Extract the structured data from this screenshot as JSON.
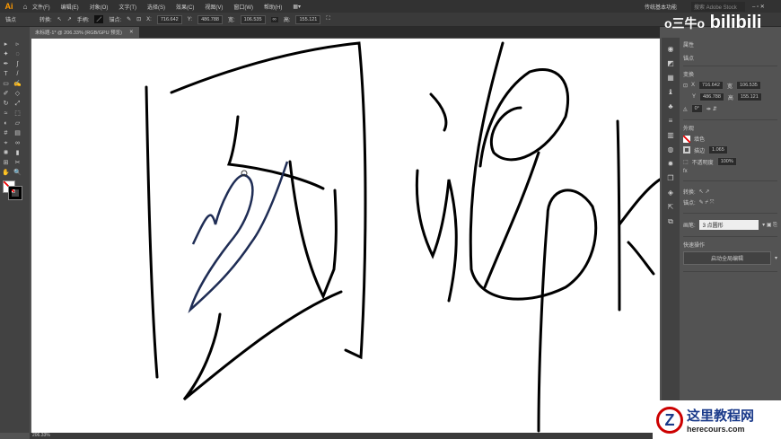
{
  "app": {
    "logo": "Ai",
    "menus": [
      "文件(F)",
      "编辑(E)",
      "对象(O)",
      "文字(T)",
      "选择(S)",
      "效果(C)",
      "视图(V)",
      "窗口(W)",
      "帮助(H)"
    ],
    "workspace": "传统基本功能",
    "search_placeholder": "搜索 Adobe Stock"
  },
  "control": {
    "mode": "锚点",
    "convert": "转换:",
    "handles": "手柄:",
    "anchors": "锚点:",
    "x_label": "X:",
    "x": "716.642",
    "y_label": "Y:",
    "y": "486.788",
    "w_label": "宽:",
    "w": "106.535",
    "h_label": "高:",
    "h": "155.121"
  },
  "document": {
    "tab": "未标题-1* @ 206.33% (RGB/GPU 预览)",
    "zoom": "206.33%"
  },
  "properties": {
    "tab": "属性",
    "section_anchor": "锚点",
    "section_transform": "变换",
    "x_label": "X",
    "x": "716.642",
    "y_label": "Y",
    "y": "486.788",
    "w_label": "宽",
    "w": "106.535",
    "h_label": "高",
    "h": "155.121",
    "angle": "0°",
    "appearance": "外观",
    "fill": "填色",
    "stroke": "描边",
    "stroke_value": "1.065",
    "opacity_label": "不透明度",
    "opacity": "100%",
    "fx": "fx",
    "convert": "转换:",
    "anchors": "锚点:",
    "brush_label": "画笔:",
    "brush": "3 点圆形",
    "quick_actions": "快速操作",
    "global_edit": "启动全局编辑"
  },
  "watermarks": {
    "uploader": "o三牛o",
    "site": "bilibili",
    "site2": "这里教程网",
    "site2_url": "herecours.com"
  }
}
